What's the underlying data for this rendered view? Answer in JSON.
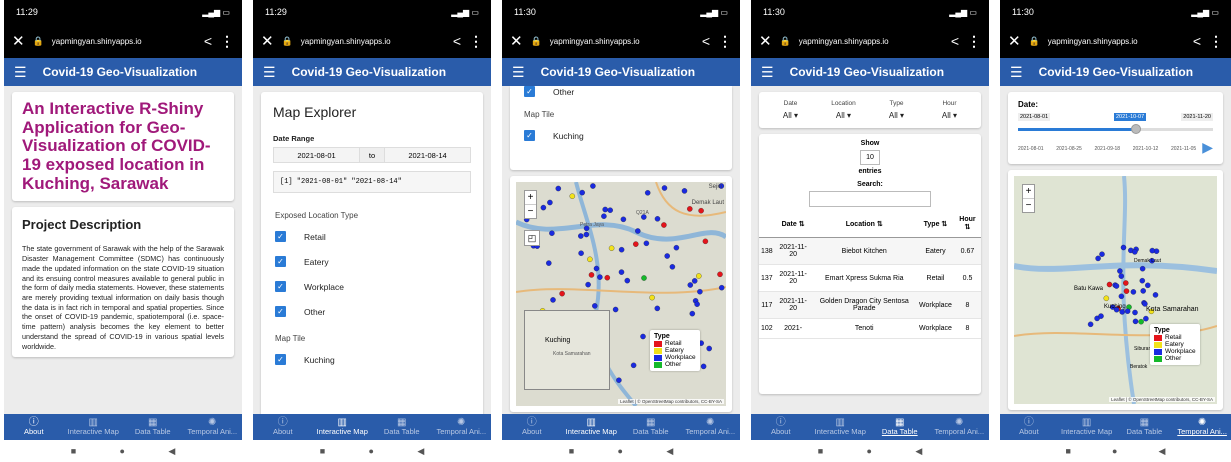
{
  "common": {
    "app_title": "Covid-19 Geo-Visualization",
    "url": "yapmingyan.shinyapps.io",
    "nav": [
      "About",
      "Interactive Map",
      "Data Table",
      "Temporal Ani..."
    ]
  },
  "phone1": {
    "time": "11:29",
    "title": "An Interactive R-Shiny Application for Geo-Visualization of COVID-19 exposed location in Kuching, Sarawak",
    "pd_heading": "Project Description",
    "pd_body": "The state government of Sarawak with the help of the Sarawak Disaster Management Committee (SDMC) has continuously made the updated information on the state COVID-19 situation and its ensuing control measures available to general public in the form of daily media statements. However, these statements are merely providing textual information on daily basis though the data is in fact rich in temporal and spatial properties. Since the onset of COVID-19 pandemic, spatiotemporal (i.e. space-time pattern) analysis becomes the key element to better understand the spread of COVID-19 in various spatial levels worldwide."
  },
  "phone2": {
    "time": "11:29",
    "heading": "Map Explorer",
    "date_label": "Date Range",
    "date_from": "2021-08-01",
    "date_sep": "to",
    "date_to": "2021-08-14",
    "verbatim": "[1] \"2021-08-01\" \"2021-08-14\"",
    "type_label": "Exposed Location Type",
    "types": [
      "Retail",
      "Eatery",
      "Workplace",
      "Other"
    ],
    "tile_label": "Map Tile",
    "tile_value": "Kuching"
  },
  "phone3": {
    "time": "11:30",
    "other": "Other",
    "tile_label": "Map Tile",
    "tile_value": "Kuching",
    "map_labels": [
      "Sejin",
      "Demak Laut",
      "Petra Jaya",
      "Q21A",
      "Kuching",
      "Kota Samarahan"
    ],
    "legend_title": "Type",
    "legend": [
      {
        "name": "Retail",
        "color": "#e4141b"
      },
      {
        "name": "Eatery",
        "color": "#f2e21a"
      },
      {
        "name": "Workplace",
        "color": "#1a2ae0"
      },
      {
        "name": "Other",
        "color": "#15b82a"
      }
    ],
    "attribution": "Leaflet | © OpenStreetMap contributors, CC-BY-SA"
  },
  "phone4": {
    "time": "11:30",
    "filters": [
      {
        "label": "Date",
        "value": "All"
      },
      {
        "label": "Location",
        "value": "All"
      },
      {
        "label": "Type",
        "value": "All"
      },
      {
        "label": "Hour",
        "value": "All"
      }
    ],
    "show": "Show",
    "entries_val": "10",
    "entries": "entries",
    "search": "Search:",
    "headers": [
      "",
      "Date",
      "Location",
      "Type",
      "Hour"
    ],
    "rows": [
      {
        "id": "138",
        "date": "2021-11-20",
        "loc": "Biebot Kitchen",
        "type": "Eatery",
        "hour": "0.67"
      },
      {
        "id": "137",
        "date": "2021-11-20",
        "loc": "Emart Xpress Sukma Ria",
        "type": "Retail",
        "hour": "0.5"
      },
      {
        "id": "117",
        "date": "2021-11-20",
        "loc": "Golden Dragon City Sentosa Parade",
        "type": "Workplace",
        "hour": "8"
      },
      {
        "id": "102",
        "date": "2021-",
        "loc": "Tenoti",
        "type": "Workplace",
        "hour": "8"
      }
    ]
  },
  "phone5": {
    "time": "11:30",
    "date_label": "Date:",
    "slider_min": "2021-08-01",
    "slider_val": "2021-10-07",
    "slider_max": "2021-11-20",
    "ticks": [
      "2021-08-01",
      "2021-08-25",
      "2021-09-18",
      "2021-10-12",
      "2021-11-05"
    ],
    "map_labels": [
      "Batu Kawa",
      "Kuching",
      "Kota Samarahan",
      "Siburan",
      "Beratok",
      "Demak Laut"
    ],
    "legend_title": "Type",
    "legend": [
      {
        "name": "Retail",
        "color": "#e4141b"
      },
      {
        "name": "Eatery",
        "color": "#f2e21a"
      },
      {
        "name": "Workplace",
        "color": "#1a2ae0"
      },
      {
        "name": "Other",
        "color": "#15b82a"
      }
    ],
    "attribution": "Leaflet | © OpenStreetMap contributors, CC-BY-SA"
  }
}
